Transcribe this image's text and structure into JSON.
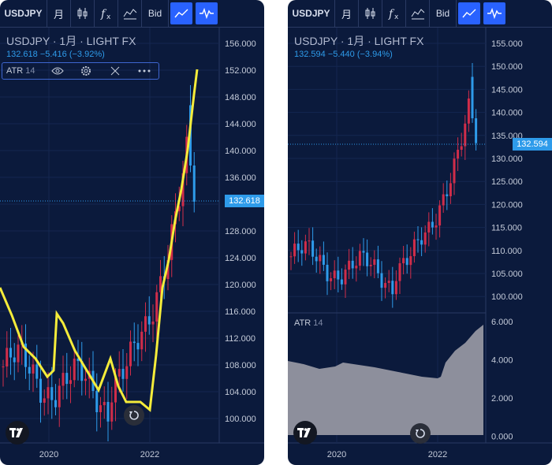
{
  "panels": [
    {
      "toolbar": {
        "symbol": "USDJPY",
        "interval": "月",
        "bid": "Bid"
      },
      "legend": {
        "title": "USDJPY · 1月 · LIGHT FX",
        "price": "132.618",
        "change": "−5.416",
        "change_pct": "(−3.92%)"
      },
      "indicator": {
        "name": "ATR",
        "length": "14"
      },
      "price_axis": [
        "156.000",
        "152.000",
        "148.000",
        "144.000",
        "140.000",
        "136.000",
        "132.000",
        "128.000",
        "124.000",
        "120.000",
        "116.000",
        "112.000",
        "108.000",
        "104.000",
        "100.000"
      ],
      "time_axis": [
        "2020",
        "2022"
      ],
      "last_price_tag": "132.618"
    },
    {
      "toolbar": {
        "symbol": "USDJPY",
        "interval": "月",
        "bid": "Bid"
      },
      "legend": {
        "title": "USDJPY · 1月 · LIGHT FX",
        "price": "132.594",
        "change": "−5.440",
        "change_pct": "(−3.94%)"
      },
      "indicator": {
        "name": "ATR",
        "length": "14"
      },
      "price_axis": [
        "155.000",
        "150.000",
        "145.000",
        "140.000",
        "135.000",
        "130.000",
        "125.000",
        "120.000",
        "115.000",
        "110.000",
        "105.000",
        "100.000"
      ],
      "atr_axis": [
        "6.000",
        "4.000",
        "2.000",
        "0.000"
      ],
      "time_axis": [
        "2020",
        "2022"
      ],
      "last_price_tag": "132.594"
    }
  ],
  "colors": {
    "background": "#0b1a3c",
    "up": "#d12d4a",
    "down": "#2e9bea",
    "atr_line": "#f5ec3a",
    "atr_area": "#8d8f9c",
    "accent": "#2962ff"
  },
  "icons": [
    "candles-icon",
    "fx-icon",
    "indicators-icon",
    "line-chart-icon",
    "pulse-icon",
    "eye-icon",
    "gear-icon",
    "close-icon",
    "more-icon",
    "tradingview-logo",
    "reset-icon"
  ]
}
